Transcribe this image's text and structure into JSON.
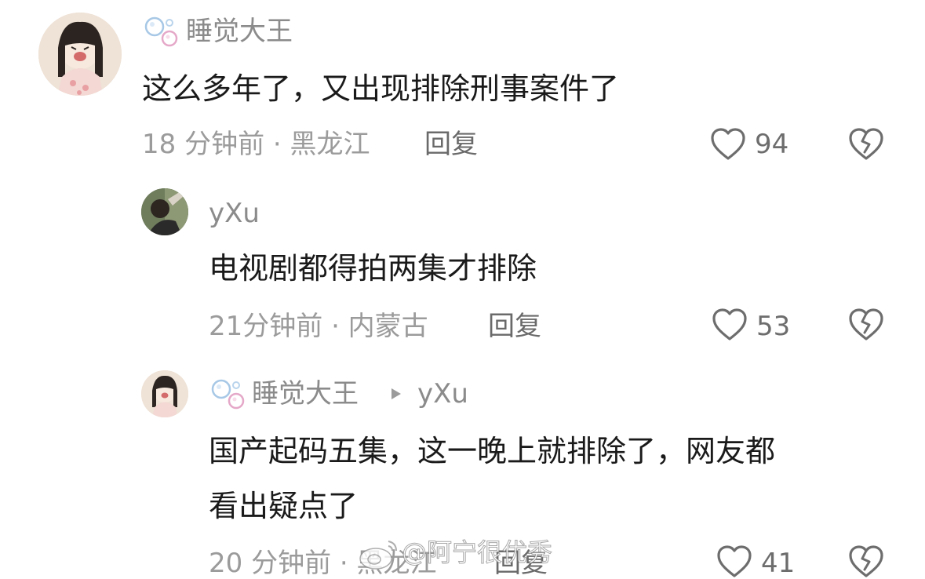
{
  "comments": [
    {
      "username": "睡觉大王",
      "text": "这么多年了，又出现排除刑事案件了",
      "meta": "18 分钟前 · 黑龙江",
      "reply_label": "回复",
      "likes": "94"
    },
    {
      "username": "yXu",
      "text": "电视剧都得拍两集才排除",
      "meta": "21分钟前 · 内蒙古",
      "reply_label": "回复",
      "likes": "53"
    },
    {
      "username": "睡觉大王",
      "reply_to": "yXu",
      "text_line1": "国产起码五集，这一晚上就排除了，网友都",
      "text_line2": "看出疑点了",
      "meta": "20 分钟前 · 黑龙江",
      "reply_label": "回复",
      "likes": "41"
    }
  ],
  "watermark": "@阿宁很优秀",
  "colors": {
    "username": "#8b8b8b",
    "meta": "#9b9b9b",
    "text": "#1a1a1a",
    "icon": "#6d6d6d"
  }
}
